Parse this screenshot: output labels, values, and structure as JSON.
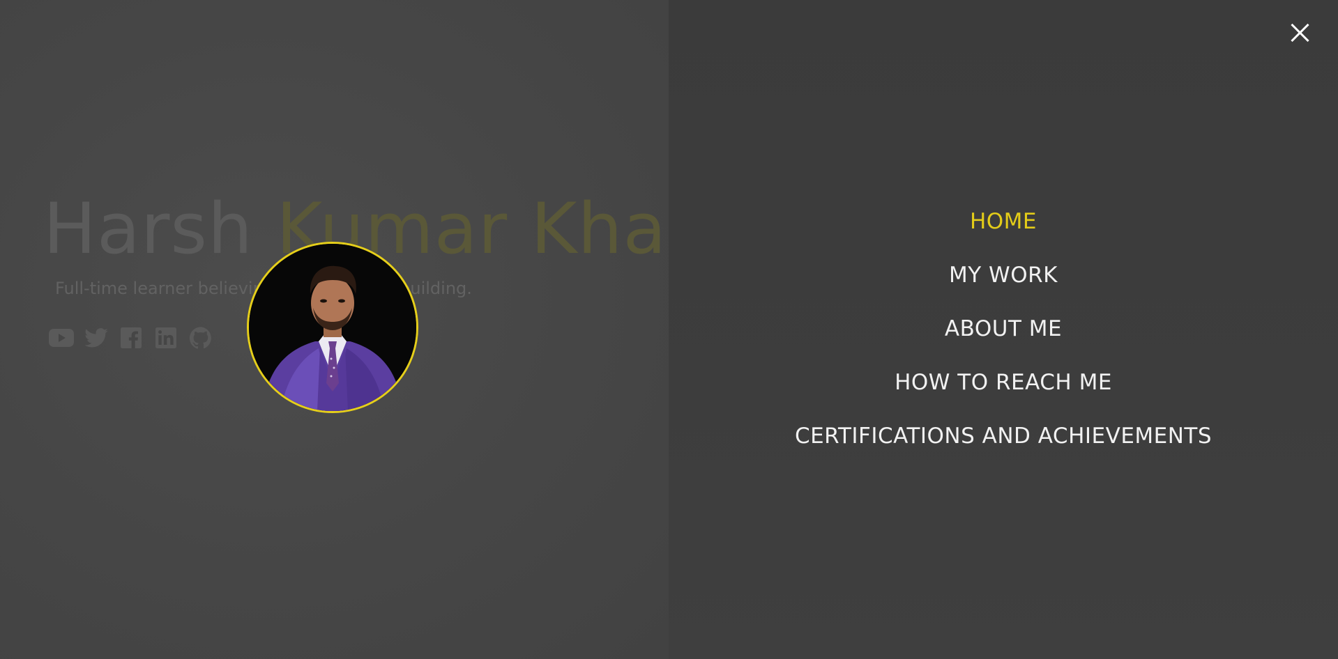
{
  "hero": {
    "first_name": "Harsh",
    "last_name": "Kumar Khatri",
    "tagline": "Full-time learner believing in community building.",
    "socials": [
      {
        "icon": "youtube-icon"
      },
      {
        "icon": "twitter-icon"
      },
      {
        "icon": "facebook-icon"
      },
      {
        "icon": "linkedin-icon"
      },
      {
        "icon": "github-icon"
      }
    ]
  },
  "nav": {
    "items": [
      {
        "label": "HOME",
        "active": true
      },
      {
        "label": "MY WORK"
      },
      {
        "label": "ABOUT ME"
      },
      {
        "label": "HOW TO REACH ME"
      },
      {
        "label": "CERTIFICATIONS AND ACHIEVEMENTS"
      }
    ],
    "close_icon": "close-icon"
  },
  "colors": {
    "accent": "#e3cc19",
    "nav_text": "#f2f2f2",
    "overlay_bg": "#3b3b3b",
    "page_bg": "#484848"
  }
}
